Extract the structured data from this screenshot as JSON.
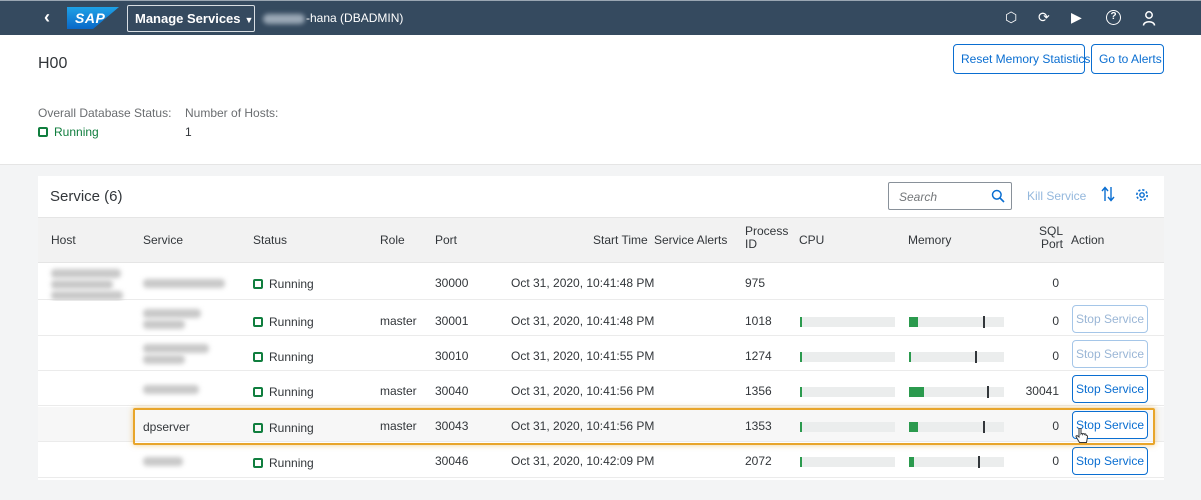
{
  "shell": {
    "app_title": "Manage Services",
    "context_suffix": "-hana (DBADMIN)",
    "logo_text": "SAP"
  },
  "header": {
    "title": "H00",
    "reset_button": "Reset Memory Statistics",
    "alerts_button": "Go to Alerts",
    "db_status_label": "Overall Database Status:",
    "db_status_value": "Running",
    "hosts_label": "Number of Hosts:",
    "hosts_value": "1"
  },
  "table": {
    "title": "Service (6)",
    "search_placeholder": "Search",
    "kill_label": "Kill Service",
    "columns": {
      "host": "Host",
      "service": "Service",
      "status": "Status",
      "role": "Role",
      "port": "Port",
      "start_time": "Start Time",
      "service_alerts": "Service Alerts",
      "process_id_1": "Process",
      "process_id_2": "ID",
      "cpu": "CPU",
      "memory": "Memory",
      "sql_port_1": "SQL",
      "sql_port_2": "Port",
      "action": "Action"
    },
    "rows": [
      {
        "service": "",
        "status": "Running",
        "role": "",
        "port": "30000",
        "start_time": "Oct 31, 2020, 10:41:48 PM",
        "pid": "975",
        "sql_port": "0",
        "action": ""
      },
      {
        "service": "",
        "status": "Running",
        "role": "master",
        "port": "30001",
        "start_time": "Oct 31, 2020, 10:41:48 PM",
        "pid": "1018",
        "sql_port": "0",
        "action": "Stop Service",
        "cpu": 0.01,
        "memory": 0.09,
        "memory_mark": 0.78
      },
      {
        "service": "",
        "status": "Running",
        "role": "",
        "port": "30010",
        "start_time": "Oct 31, 2020, 10:41:55 PM",
        "pid": "1274",
        "sql_port": "0",
        "action": "Stop Service",
        "cpu": 0.01,
        "memory": 0.01,
        "memory_mark": 0.69
      },
      {
        "service": "",
        "status": "Running",
        "role": "master",
        "port": "30040",
        "start_time": "Oct 31, 2020, 10:41:56 PM",
        "pid": "1356",
        "sql_port": "30041",
        "action": "Stop Service",
        "cpu": 0.01,
        "memory": 0.16,
        "memory_mark": 0.82
      },
      {
        "service": "dpserver",
        "status": "Running",
        "role": "master",
        "port": "30043",
        "start_time": "Oct 31, 2020, 10:41:56 PM",
        "pid": "1353",
        "sql_port": "0",
        "action": "Stop Service",
        "cpu": 0.01,
        "memory": 0.09,
        "memory_mark": 0.78
      },
      {
        "service": "",
        "status": "Running",
        "role": "",
        "port": "30046",
        "start_time": "Oct 31, 2020, 10:42:09 PM",
        "pid": "2072",
        "sql_port": "0",
        "action": "Stop Service",
        "cpu": 0.01,
        "memory": 0.05,
        "memory_mark": 0.73
      }
    ]
  },
  "colors": {
    "shell_bg": "#354a5f",
    "accent": "#0a6ed1",
    "positive": "#107e3e",
    "highlight": "#e8a52a"
  }
}
